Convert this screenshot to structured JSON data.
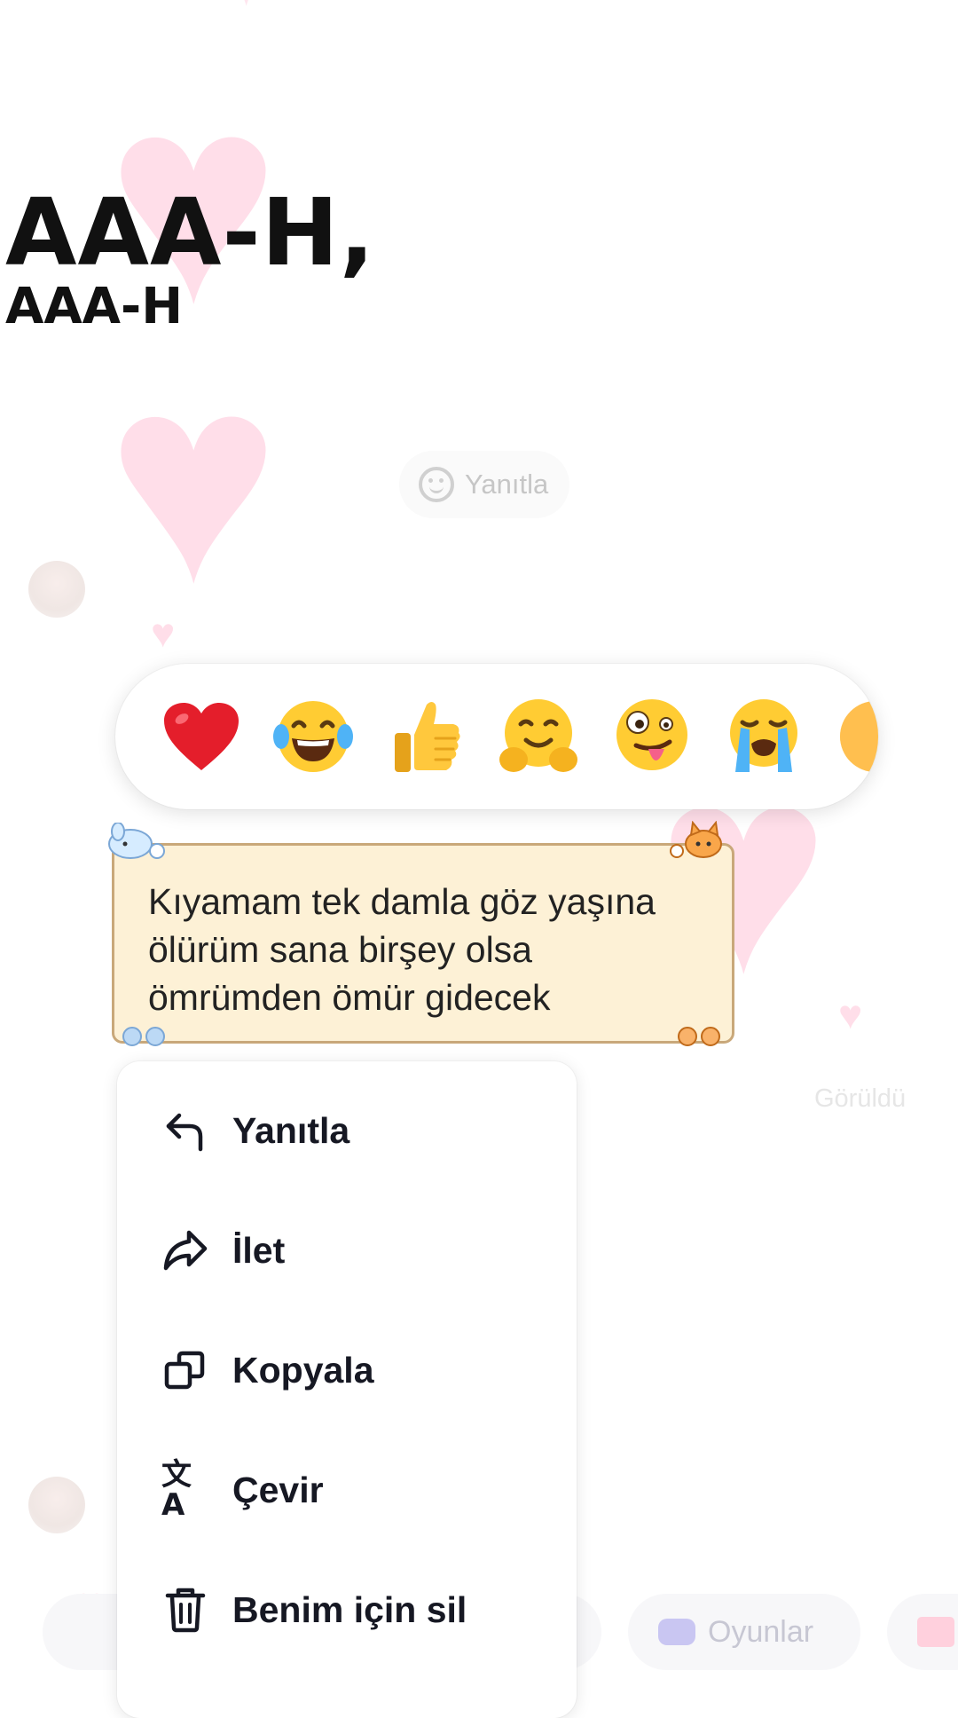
{
  "background": {
    "reply_chip_label": "Yanıtla",
    "seen_label": "Görüldü",
    "games_label": "Oyunlar"
  },
  "overlay": {
    "title": "AAA-H,",
    "subtitle": "AAA-H"
  },
  "reactions": [
    {
      "name": "red-heart",
      "icon": "red-heart-emoji"
    },
    {
      "name": "tears-of-joy",
      "icon": "tears-of-joy-emoji"
    },
    {
      "name": "thumbs-up",
      "icon": "thumbs-up-emoji"
    },
    {
      "name": "hugging-face",
      "icon": "hugging-face-emoji"
    },
    {
      "name": "zany-face",
      "icon": "zany-face-emoji"
    },
    {
      "name": "loudly-crying",
      "icon": "loudly-crying-emoji"
    },
    {
      "name": "more-partially-visible",
      "icon": "emoji-partially-visible"
    }
  ],
  "message": {
    "text": "Kıyamam tek damla göz yaşına\nölürüm sana birşey olsa\nömrümden ömür gidecek"
  },
  "menu": {
    "items": [
      {
        "label": "Yanıtla",
        "icon": "reply-arrow-icon"
      },
      {
        "label": "İlet",
        "icon": "forward-arrow-icon"
      },
      {
        "label": "Kopyala",
        "icon": "copy-icon"
      },
      {
        "label": "Çevir",
        "icon": "translate-icon"
      },
      {
        "label": "Benim için sil",
        "icon": "trash-icon"
      }
    ]
  },
  "colors": {
    "bubble_fill": "#fdf1d6",
    "bubble_border": "#c9a87a",
    "background_heart": "#ffd3e2",
    "menu_text": "#161823"
  }
}
